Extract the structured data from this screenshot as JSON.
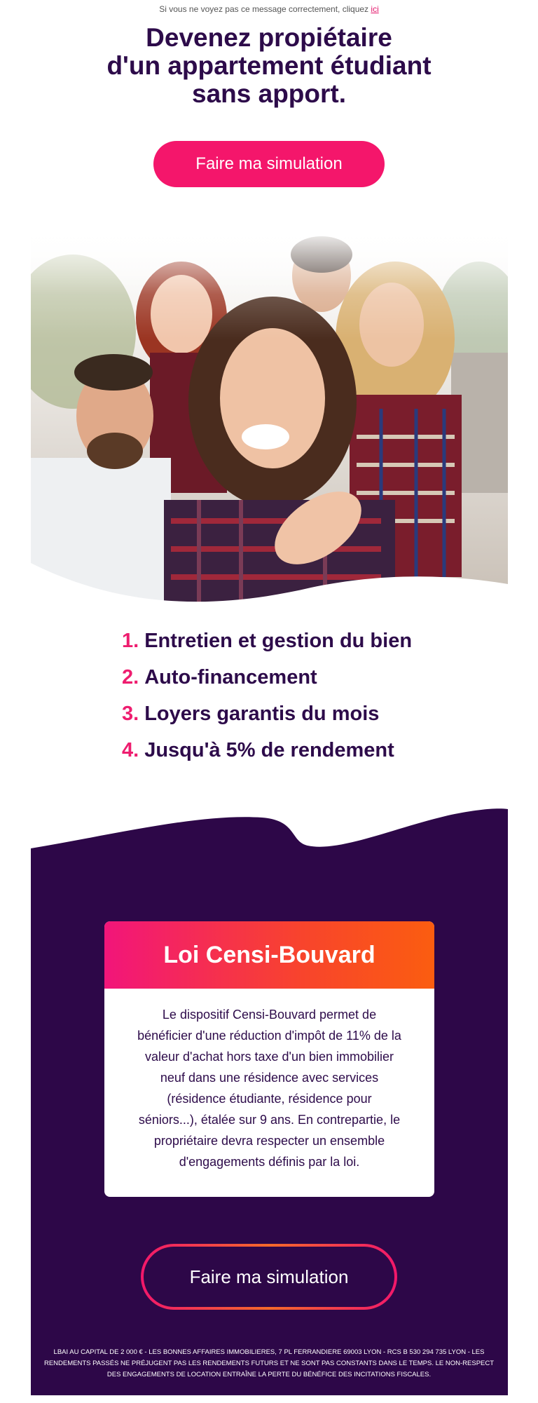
{
  "preheader": {
    "text": "Si vous ne voyez pas ce message correctement, cliquez",
    "link": "ici"
  },
  "headline": {
    "line1": "Devenez propiétaire",
    "line2": "d'un appartement étudiant",
    "line3": "sans apport."
  },
  "cta_top": {
    "label": "Faire ma simulation"
  },
  "benefits": [
    {
      "num": "1.",
      "text": "Entretien et gestion du bien"
    },
    {
      "num": "2.",
      "text": "Auto-financement"
    },
    {
      "num": "3.",
      "text": "Loyers garantis du mois"
    },
    {
      "num": "4.",
      "text": "Jusqu'à 5% de rendement"
    }
  ],
  "card": {
    "title": "Loi Censi-Bouvard",
    "body": "Le dispositif Censi-Bouvard permet de bénéficier d'une réduction d'impôt de 11% de la valeur d'achat hors taxe d'un bien immobilier neuf dans une résidence avec services (résidence étudiante, résidence pour séniors...), étalée sur 9 ans. En contrepartie, le propriétaire devra respecter un ensemble d'engagements définis par la loi."
  },
  "cta_bottom": {
    "label": "Faire ma simulation"
  },
  "legal": "LBAI AU CAPITAL DE 2 000 € - LES BONNES AFFAIRES IMMOBILIERES, 7 PL FERRANDIERE 69003 LYON - RCS B 530 294 735 LYON - LES RENDEMENTS PASSÉS NE PRÉJUGENT PAS LES RENDEMENTS FUTURS ET NE SONT PAS CONSTANTS DANS LE TEMPS. LE NON-RESPECT DES ENGAGEMENTS DE LOCATION ENTRAÎNE LA PERTE DU BÉNÉFICE DES INCITATIONS FISCALES.",
  "colors": {
    "brand_dark": "#2d0b4a",
    "brand_pink": "#f4166b",
    "brand_orange": "#fb5d10",
    "section_purple": "#2d0748"
  }
}
